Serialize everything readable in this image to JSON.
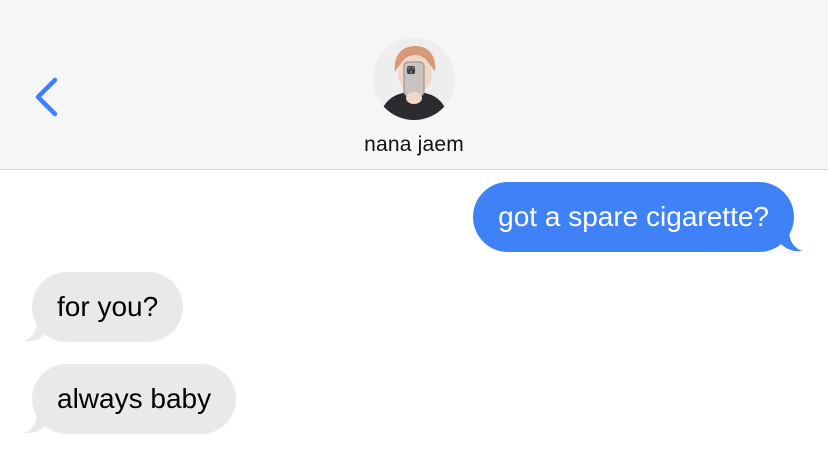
{
  "header": {
    "contact_name": "nana jaem",
    "back_icon": "chevron-left-icon",
    "avatar_icon": "contact-avatar-photo"
  },
  "messages": [
    {
      "direction": "outgoing",
      "text": "got a spare cigarette?"
    },
    {
      "direction": "incoming",
      "text": "for you?"
    },
    {
      "direction": "incoming",
      "text": "always baby"
    }
  ],
  "colors": {
    "accent": "#3f82f7",
    "outgoing_bubble": "#3f82f7",
    "incoming_bubble": "#e9e9eb",
    "header_bg": "#f6f6f6",
    "page_bg": "#ffffff"
  }
}
